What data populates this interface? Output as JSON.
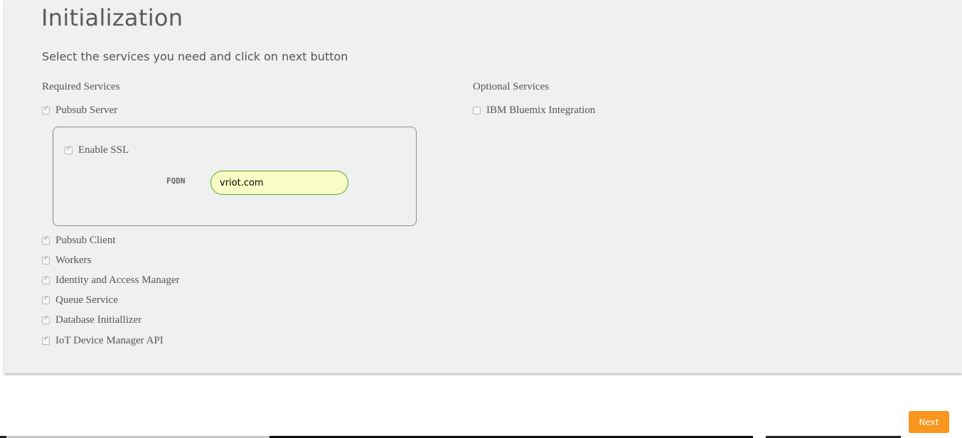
{
  "page": {
    "title": "Initialization",
    "subtitle": "Select the services you need and click on next button"
  },
  "required": {
    "label": "Required Services",
    "pubsub_server": "Pubsub Server",
    "enable_ssl": "Enable SSL",
    "fqdn_label": "FQDN",
    "fqdn_value": "vriot.com",
    "items": [
      "Pubsub Client",
      "Workers",
      "Identity and Access Manager",
      "Queue Service",
      "Database Initiallizer",
      "IoT Device Manager API"
    ]
  },
  "optional": {
    "label": "Optional Services",
    "items": [
      "IBM Bluemix Integration"
    ]
  },
  "footer": {
    "next_label": "Next"
  },
  "colors": {
    "accent": "#f8961e",
    "input_border": "#4caa2c",
    "input_bg": "#fafcc6",
    "panel_bg": "#f0f0f0"
  }
}
